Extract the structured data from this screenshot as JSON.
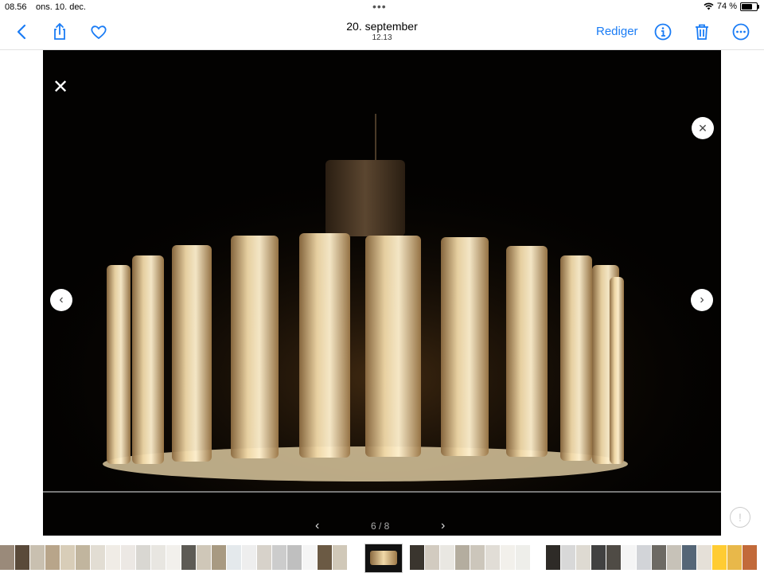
{
  "status_bar": {
    "time": "08.56",
    "date": "ons. 10. dec.",
    "battery": "74 %",
    "battery_level": 0.74
  },
  "nav": {
    "title": "20. september",
    "subtitle": "12.13",
    "edit_label": "Rediger"
  },
  "viewer": {
    "pager": "6 / 8"
  },
  "colors": {
    "accent": "#1a7cf5",
    "photo_bg": "#030201",
    "glow": "#f3d9a6"
  },
  "thumbnails": {
    "before_colors": [
      "#9a8a7a",
      "#5a4a3a",
      "#c9c0b0",
      "#b8a58a",
      "#d8cdb8",
      "#c1b59e",
      "#e2ddd3",
      "#f0ece6",
      "#ece8e4",
      "#d9d7d2",
      "#e8e6e1",
      "#f2f0ec",
      "#5d5b55",
      "#cfc7b8",
      "#a89a82",
      "#e4e9ec",
      "#eeeeee",
      "#d7d2ca",
      "#cccccc",
      "#bfbfbf",
      "#f5f5f5",
      "#6b5a44",
      "#d0c8b8"
    ],
    "after_colors": [
      "#3a352e",
      "#d2cbc0",
      "#e9e7e2",
      "#b4ad9f",
      "#ccc6bb",
      "#e1ddd6",
      "#f2f0eb",
      "#eeeeea",
      "#ffffff",
      "#2e2b27",
      "#d8d8d8",
      "#dedad2",
      "#414141",
      "#4f4b45",
      "#f5f5f5",
      "#d2d4d8",
      "#6d6a64",
      "#c7c2b8",
      "#556677",
      "#e5e0d8",
      "#ffcc33",
      "#e8b84a",
      "#c26a3a",
      "#5577aa",
      "#ddcc88",
      "#eeaa33",
      "#223344"
    ]
  }
}
